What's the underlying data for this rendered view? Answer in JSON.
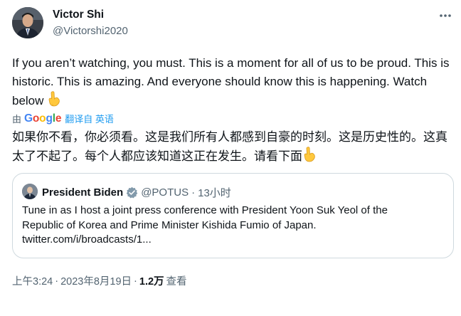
{
  "author": {
    "name": "Victor Shi",
    "handle": "@Victorshi2020"
  },
  "tweet": {
    "text": "If you aren’t watching, you must. This is a moment for all of us to be proud. This is historic. This is amazing. And everyone should know this is happening. Watch below",
    "emoji": "pointing-down-hand-icon"
  },
  "translation": {
    "by_prefix": "由",
    "provider": [
      "G",
      "o",
      "o",
      "g",
      "l",
      "e"
    ],
    "label": "翻译自 英语",
    "text": "如果你不看，你必须看。这是我们所有人都感到自豪的时刻。这是历史性的。这真太了不起了。每个人都应该知道这正在发生。请看下面"
  },
  "quote": {
    "name": "President Biden",
    "handle": "@POTUS",
    "separator": "·",
    "time": "13小时",
    "text_line1": "Tune in as I host a joint press conference with President Yoon Suk Yeol of the",
    "text_line2": "Republic of Korea and Prime Minister Kishida Fumio of Japan.",
    "link": "twitter.com/i/broadcasts/1..."
  },
  "meta": {
    "time": "上午3:24",
    "date": "2023年8月19日",
    "separator": "·",
    "views_count": "1.2万",
    "views_label": "查看"
  },
  "colors": {
    "text": "#0f1419",
    "secondary": "#536471",
    "accent": "#1d9bf0",
    "border": "#cfd9de"
  }
}
